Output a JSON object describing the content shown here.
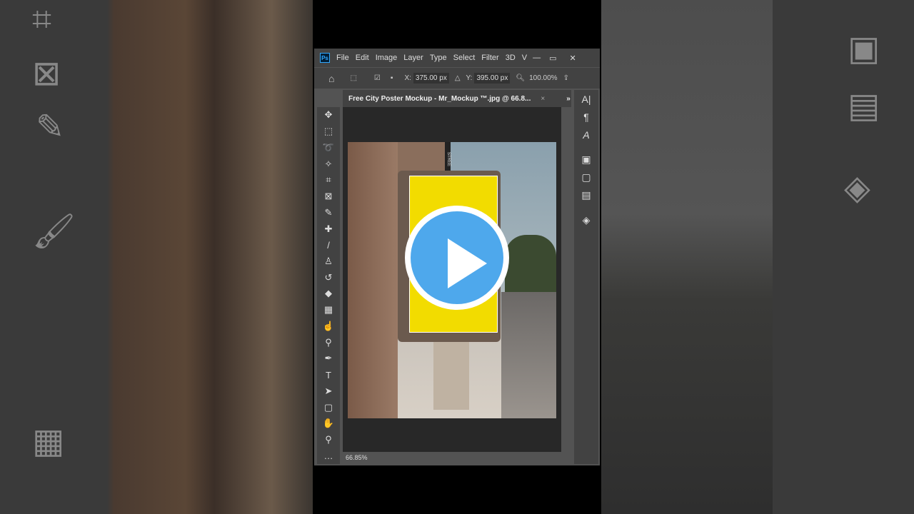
{
  "app": {
    "logo": "Ps",
    "menu": [
      "File",
      "Edit",
      "Image",
      "Layer",
      "Type",
      "Select",
      "Filter",
      "3D",
      "V"
    ]
  },
  "options": {
    "x_label": "X:",
    "x_value": "375.00 px",
    "y_label": "Y:",
    "y_value": "395.00 px",
    "zoom": "100.00%"
  },
  "document": {
    "tab_title": "Free City Poster Mockup - Mr_Mockup ™.jpg @ 66.8...",
    "close": "×",
    "zoom_status": "66.85%"
  },
  "street_sign": "STREE",
  "colors": {
    "poster": "#f2dc00",
    "play_button": "#4ea8ec"
  },
  "tools": [
    "move-icon",
    "marquee-icon",
    "lasso-icon",
    "quick-select-icon",
    "crop-icon",
    "frame-icon",
    "eyedropper-icon",
    "healing-icon",
    "brush-icon",
    "stamp-icon",
    "history-brush-icon",
    "eraser-icon",
    "gradient-icon",
    "smudge-icon",
    "dodge-icon",
    "pen-icon",
    "type-icon",
    "path-select-icon",
    "shape-icon",
    "hand-icon",
    "zoom-icon",
    "more-icon"
  ]
}
